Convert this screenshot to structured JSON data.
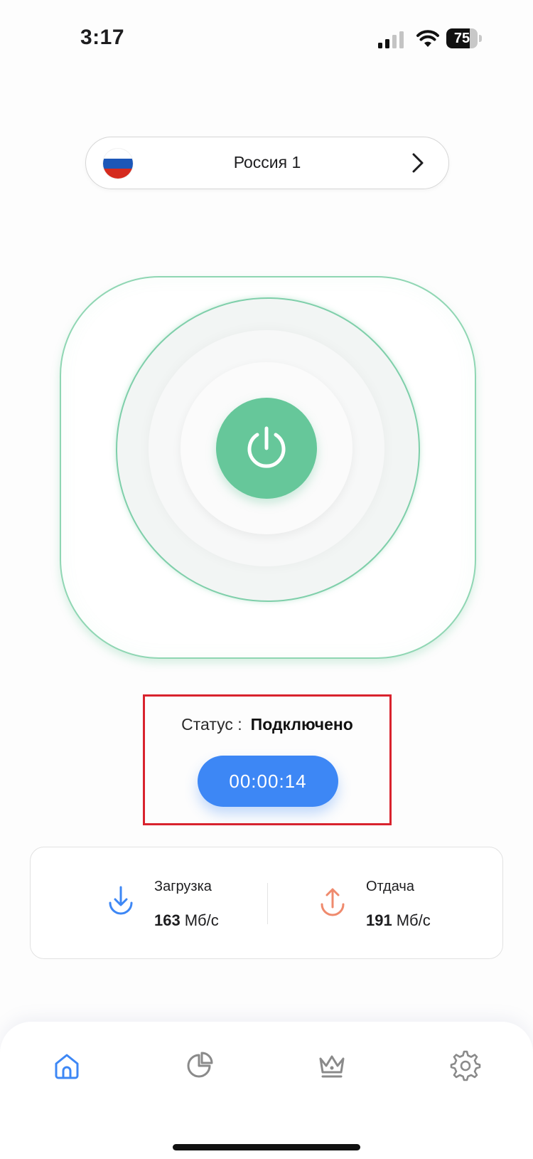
{
  "status_bar": {
    "time": "3:17",
    "battery_level": "75",
    "battery_fraction": 0.75
  },
  "server": {
    "name": "Россия 1",
    "flag_colors": [
      "#ffffff",
      "#1c57b8",
      "#d52b1e"
    ]
  },
  "connection": {
    "status_label": "Статус :",
    "status_value": "Подключено",
    "timer": "00:00:14",
    "accent_color": "#66c79a"
  },
  "stats": {
    "download": {
      "title": "Загрузка",
      "value": "163",
      "unit": "Мб/с",
      "icon": "download-icon",
      "color": "#3d87f5"
    },
    "upload": {
      "title": "Отдача",
      "value": "191",
      "unit": "Мб/с",
      "icon": "upload-icon",
      "color": "#ef8a6d"
    }
  },
  "nav": {
    "items": [
      {
        "icon": "home-icon",
        "active": true
      },
      {
        "icon": "pie-chart-icon",
        "active": false
      },
      {
        "icon": "crown-icon",
        "active": false
      },
      {
        "icon": "gear-icon",
        "active": false
      }
    ],
    "active_color": "#3d87f5",
    "inactive_color": "#8a8a8a"
  }
}
